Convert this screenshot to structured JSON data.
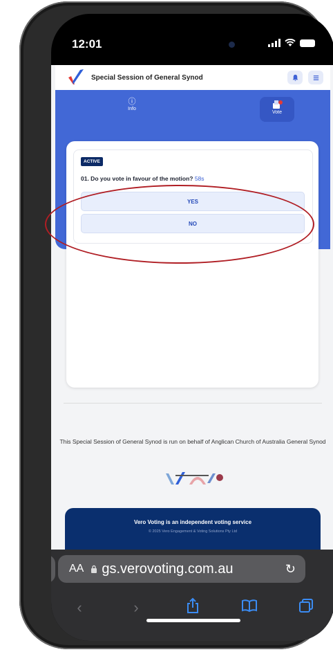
{
  "status": {
    "time": "12:01"
  },
  "site": {
    "title": "Special Session of General Synod"
  },
  "nav": {
    "info_label": "Info",
    "vote_label": "Vote"
  },
  "question": {
    "badge": "ACTIVE",
    "text": "01. Do you vote in favour of the motion?",
    "timer": "58s",
    "options": [
      "YES",
      "NO"
    ]
  },
  "footer": {
    "note": "This Special Session of General Synod is run on behalf of Anglican Church of Australia General Synod",
    "service": "Vero Voting is an independent voting service",
    "copyright": "© 2025 Vero Engagement & Voting Solutions Pty Ltd"
  },
  "browser": {
    "text_size": "AA",
    "url": "gs.verovoting.com.au"
  },
  "icons": [
    "info-icon",
    "vote-icon",
    "bell-icon",
    "menu-icon",
    "lock-icon",
    "reload-icon",
    "back-icon",
    "forward-icon",
    "share-icon",
    "bookmarks-icon",
    "tabs-icon"
  ],
  "colors": {
    "brand_blue": "#4268d6",
    "navy": "#0c2a66",
    "annotation_red": "#b01e24"
  }
}
